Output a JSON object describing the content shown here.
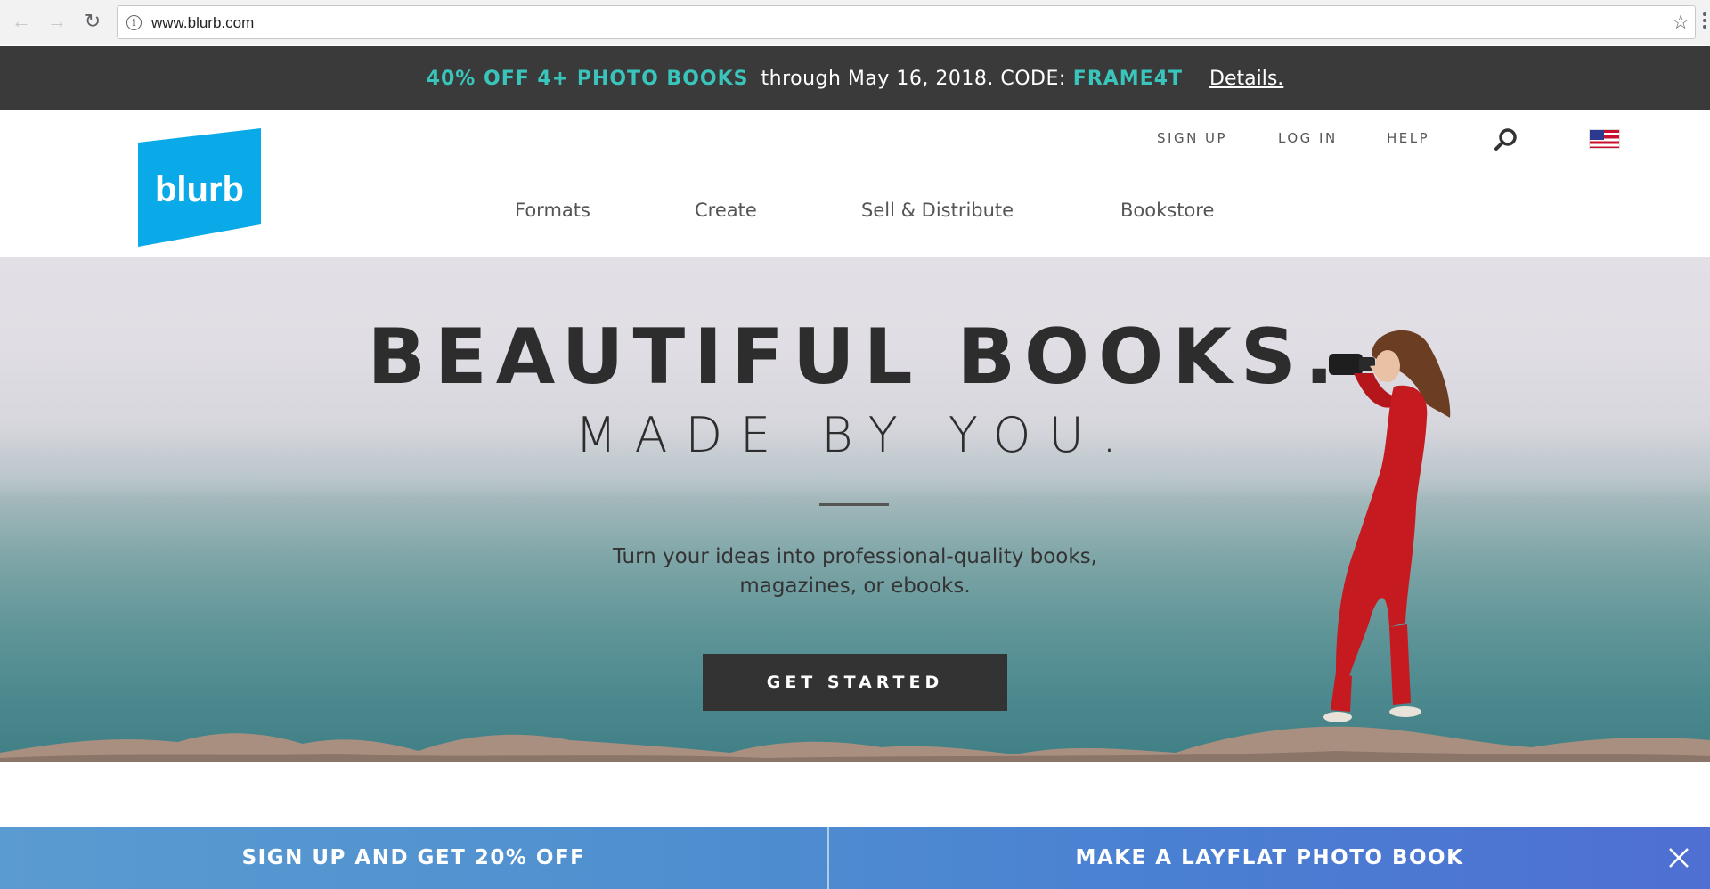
{
  "browser": {
    "url": "www.blurb.com",
    "back_icon": "arrow-left-icon",
    "forward_icon": "arrow-right-icon",
    "reload_icon": "reload-icon",
    "bookmark_icon": "star-icon"
  },
  "promo": {
    "offer": "40% OFF 4+ PHOTO BOOKS",
    "through": "through May 16, 2018. CODE:",
    "code": "FRAME4T",
    "details": "Details.",
    "accent_color": "#39c5bb"
  },
  "header": {
    "logo_text": "blurb",
    "brand_color": "#0aa9e8",
    "utility": {
      "signup": "SIGN UP",
      "login": "LOG IN",
      "help": "HELP"
    },
    "nav": [
      "Formats",
      "Create",
      "Sell & Distribute",
      "Bookstore"
    ]
  },
  "hero": {
    "title": "BEAUTIFUL BOOKS.",
    "subtitle": "MADE BY YOU.",
    "description_line1": "Turn your ideas into professional-quality books,",
    "description_line2": "magazines, or ebooks.",
    "cta": "GET STARTED"
  },
  "bottom_bar": {
    "left": "SIGN UP AND GET 20% OFF",
    "right": "MAKE A LAYFLAT PHOTO BOOK"
  }
}
